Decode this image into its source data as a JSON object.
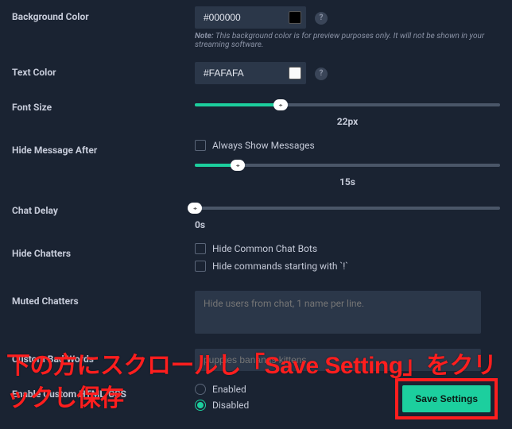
{
  "colors": {
    "accent": "#1ccf9e",
    "bg": "#1a2332",
    "fieldBg": "#2b3749",
    "overlayRed": "#ff1e1e"
  },
  "backgroundColor": {
    "label": "Background Color",
    "value": "#000000",
    "swatch": "#000000",
    "notePrefix": "Note:",
    "note": " This background color is for preview purposes only. It will not be shown in your streaming software."
  },
  "textColor": {
    "label": "Text Color",
    "value": "#FAFAFA",
    "swatch": "#FAFAFA"
  },
  "fontSize": {
    "label": "Font Size",
    "value": "22px",
    "percent": 28
  },
  "hideAfter": {
    "label": "Hide Message After",
    "alwaysValue": "Always Show Messages",
    "sliderValue": "15s",
    "percent": 14
  },
  "chatDelay": {
    "label": "Chat Delay",
    "value": "0s",
    "percent": 0
  },
  "hideChatters": {
    "label": "Hide Chatters",
    "opt1": "Hide Common Chat Bots",
    "opt2": "Hide commands starting with `!`"
  },
  "mutedChatters": {
    "label": "Muted Chatters",
    "placeholder": "Hide users from chat, 1 name per line."
  },
  "badWords": {
    "label": "Custom Bad Words",
    "placeholder": "puppies bananas kittens"
  },
  "customHtml": {
    "label": "Enable Custom HTML/CSS",
    "enabled": "Enabled",
    "disabled": "Disabled"
  },
  "saveButton": "Save Settings",
  "overlayText": "下の方にスクロールし「Save Setting」をクリックし保存"
}
